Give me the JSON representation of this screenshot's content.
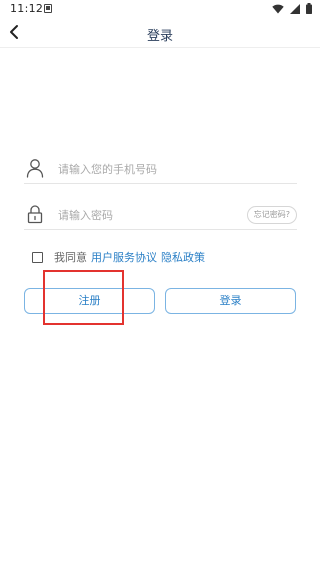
{
  "status_bar": {
    "time": "11:12"
  },
  "header": {
    "title": "登录"
  },
  "form": {
    "phone_placeholder": "请输入您的手机号码",
    "password_placeholder": "请输入密码",
    "forgot_password_label": "忘记密码?"
  },
  "agreement": {
    "prefix": "我同意",
    "user_agreement": "用户服务协议",
    "privacy_policy": "隐私政策",
    "checked": false
  },
  "buttons": {
    "register_label": "注册",
    "login_label": "登录"
  },
  "colors": {
    "accent": "#2a7fc6",
    "button_border": "#7bb4e3",
    "highlight": "#e3332f",
    "title": "#2b3f5c"
  },
  "icons": {
    "back": "chevron-left-icon",
    "user": "user-icon",
    "lock": "lock-icon",
    "wifi": "wifi-icon",
    "signal": "signal-icon",
    "battery": "battery-icon"
  }
}
